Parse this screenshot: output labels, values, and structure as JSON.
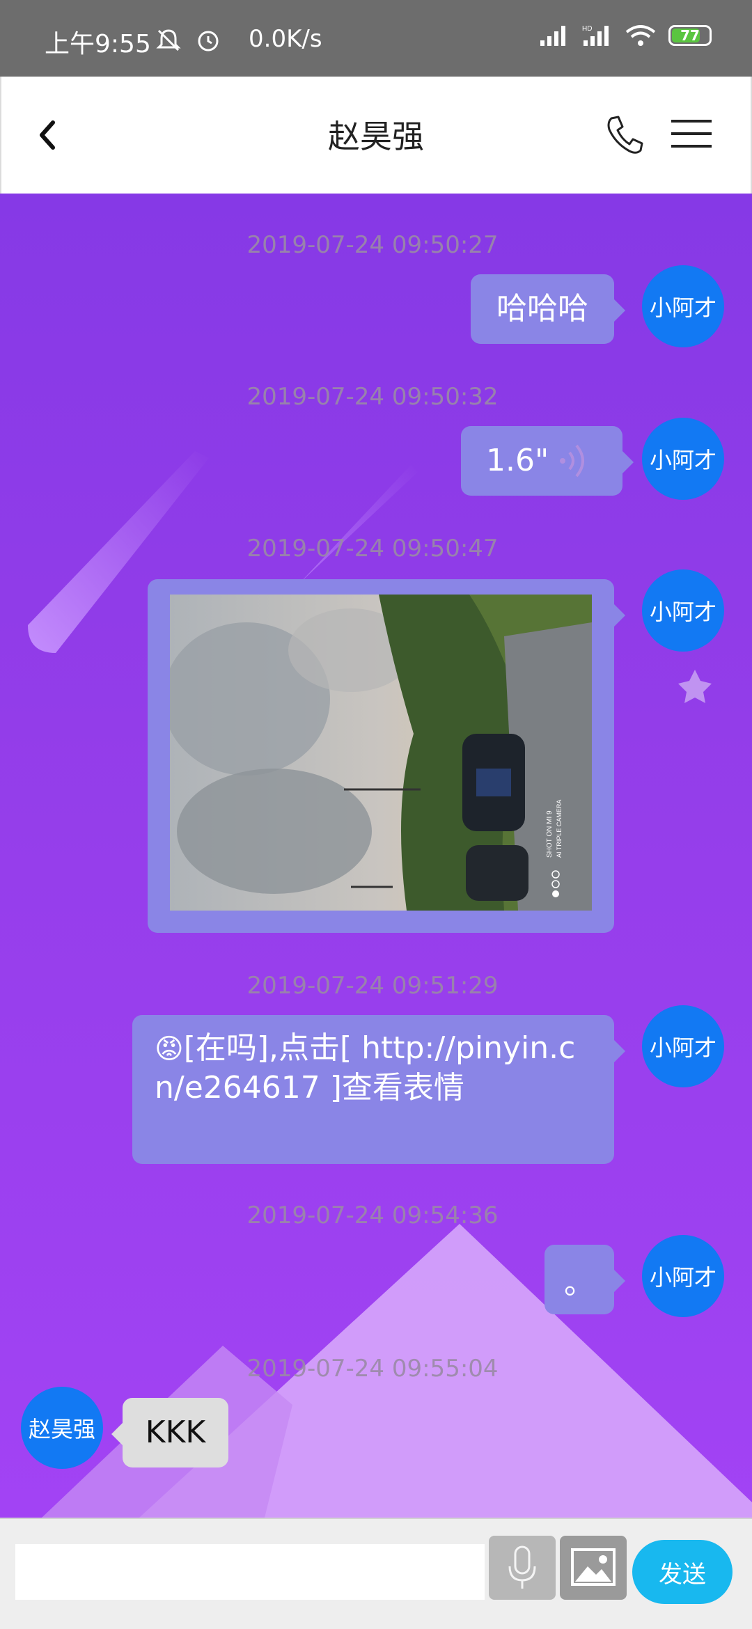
{
  "status_bar": {
    "time": "上午9:55",
    "speed": "0.0K/s",
    "battery": "77",
    "icons_left": [
      "mute-notification-icon",
      "alarm-icon"
    ],
    "icons_right": [
      "signal-icon",
      "hd-signal-icon",
      "wifi-icon",
      "battery-icon"
    ]
  },
  "header": {
    "title": "赵昊强",
    "back_icon": "chevron-left-icon",
    "phone_icon": "phone-icon",
    "menu_icon": "menu-icon"
  },
  "messages": [
    {
      "timestamp": "2019-07-24 09:50:27",
      "direction": "out",
      "type": "text",
      "avatar": "小阿才",
      "text": "哈哈哈"
    },
    {
      "timestamp": "2019-07-24 09:50:32",
      "direction": "out",
      "type": "voice",
      "avatar": "小阿才",
      "duration": "1.6\""
    },
    {
      "timestamp": "2019-07-24 09:50:47",
      "direction": "out",
      "type": "image",
      "avatar": "小阿才",
      "image_desc": "sky-and-parking-lot-photo",
      "watermark_line1": "SHOT ON MI 9",
      "watermark_line2": "AI TRIPLE CAMERA"
    },
    {
      "timestamp": "2019-07-24 09:51:29",
      "direction": "out",
      "type": "text",
      "avatar": "小阿才",
      "emoji": "😡",
      "text": "[在吗],点击[ http://pinyin.cn/e264617 ]查看表情"
    },
    {
      "timestamp": "2019-07-24 09:54:36",
      "direction": "out",
      "type": "text",
      "avatar": "小阿才",
      "text": "。"
    },
    {
      "timestamp": "2019-07-24 09:55:04",
      "direction": "in",
      "type": "text",
      "avatar": "赵昊强",
      "text": "KKK"
    }
  ],
  "input_bar": {
    "placeholder": "",
    "value": "",
    "send_label": "发送",
    "mic_icon": "microphone-icon",
    "image_icon": "image-icon"
  },
  "colors": {
    "chat_bg_top": "#8639e6",
    "chat_bg_bottom": "#a243f4",
    "bubble_out": "#8a85e6",
    "bubble_in": "#dedede",
    "avatar": "#1279f3",
    "send_button": "#18b8ef"
  }
}
